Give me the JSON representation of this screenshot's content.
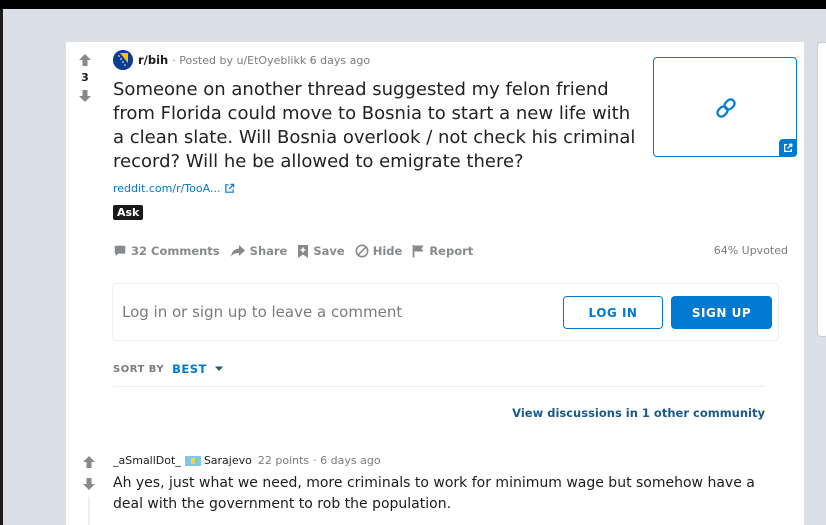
{
  "post": {
    "score": "3",
    "subreddit": "r/bih",
    "posted_by": "· Posted by u/EtOyeblikk 6 days ago",
    "title": "Someone on another thread suggested my felon friend from Florida could move to Bosnia to start a new life with a clean slate. Will Bosnia overlook / not check his criminal record? Will he be allowed to emigrate there?",
    "link_text": "reddit.com/r/TooA...",
    "flair": "Ask",
    "actions": {
      "comments": "32 Comments",
      "share": "Share",
      "save": "Save",
      "hide": "Hide",
      "report": "Report"
    },
    "upvoted": "64% Upvoted"
  },
  "comment_box": {
    "prompt": "Log in or sign up to leave a comment",
    "login_label": "LOG IN",
    "signup_label": "SIGN UP"
  },
  "sort": {
    "label": "SORT BY",
    "value": "BEST"
  },
  "other_discussions": "View discussions in 1 other community",
  "comments": [
    {
      "user": "_aSmallDot_",
      "flair": "Sarajevo",
      "points": "22 points",
      "time": "· 6 days ago",
      "body": "Ah yes, just what we need, more criminals to work for minimum wage but somehow have a deal with the government to rob the population."
    }
  ],
  "colors": {
    "accent": "#0079d3",
    "page_bg": "#dae0e6",
    "flair_bg": "#1a1a1b"
  }
}
